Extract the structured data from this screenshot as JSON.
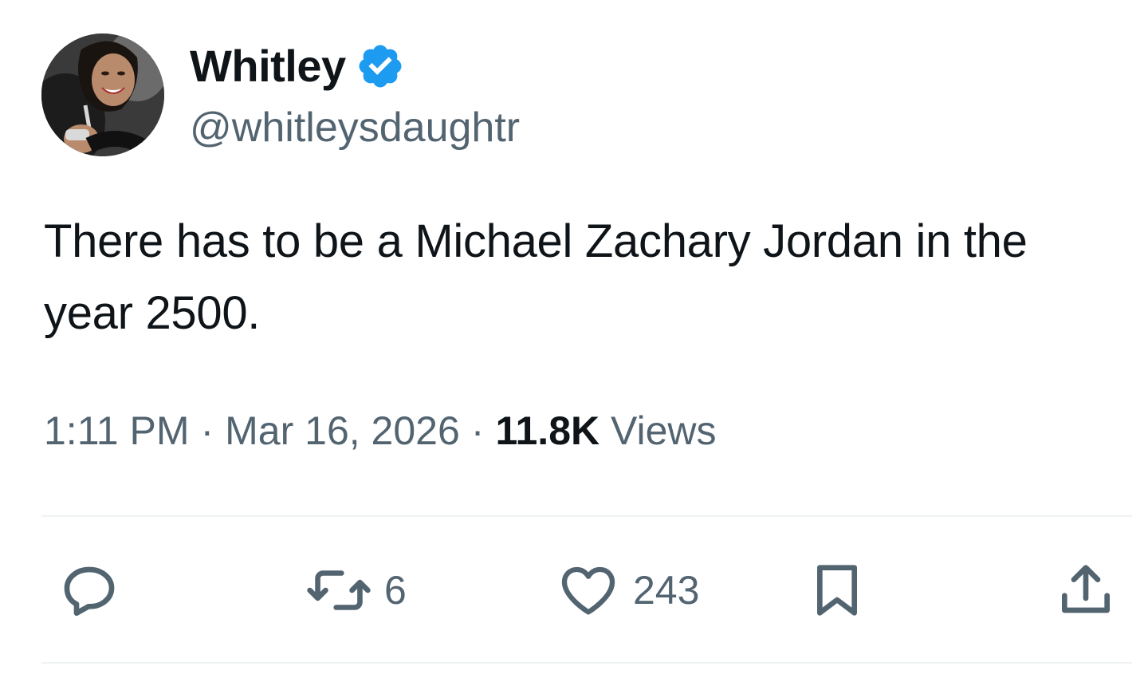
{
  "author": {
    "display_name": "Whitley",
    "handle": "@whitleysdaughtr",
    "verified": true,
    "verified_color": "#1d9bf0"
  },
  "tweet": {
    "text": "There has to be a Michael Zachary Jordan in the year 2500."
  },
  "meta": {
    "time": "1:11 PM",
    "separator": "·",
    "date": "Mar 16, 2026",
    "views_count": "11.8K",
    "views_label": "Views"
  },
  "actions": {
    "reply": {
      "icon": "reply-icon",
      "count": ""
    },
    "retweet": {
      "icon": "retweet-icon",
      "count": "6"
    },
    "like": {
      "icon": "heart-icon",
      "count": "243"
    },
    "bookmark": {
      "icon": "bookmark-icon"
    },
    "share": {
      "icon": "share-icon"
    }
  },
  "colors": {
    "text_primary": "#0f1419",
    "text_secondary": "#536471",
    "divider": "#eff3f4",
    "accent": "#1d9bf0"
  }
}
